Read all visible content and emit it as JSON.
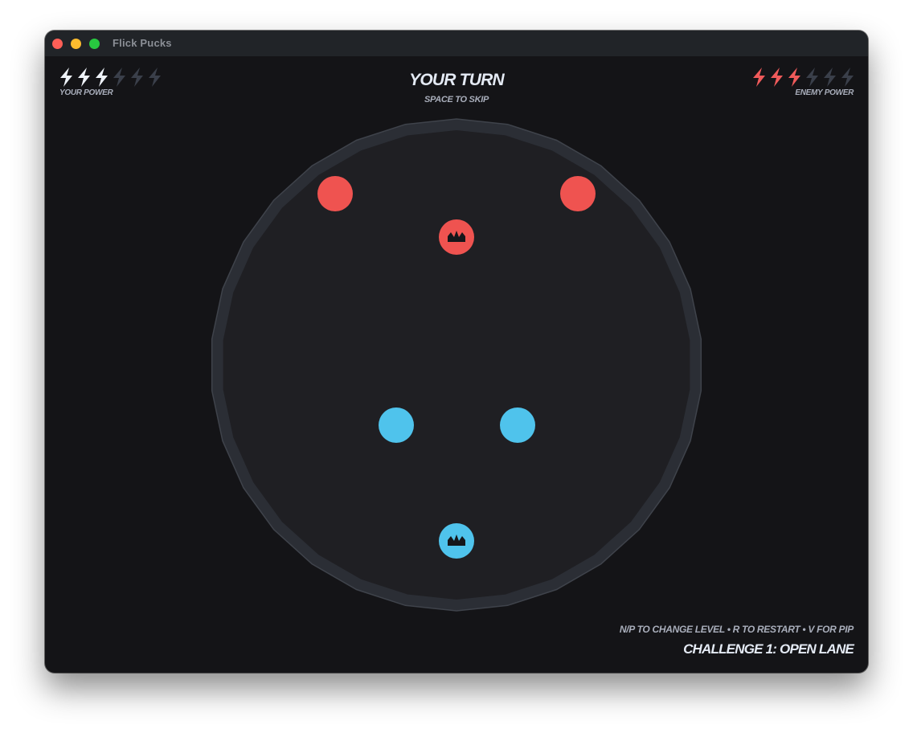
{
  "window": {
    "title": "Flick Pucks",
    "controls": [
      "close",
      "minimize",
      "maximize"
    ]
  },
  "hud": {
    "turn_label": "YOUR TURN",
    "skip_hint": "SPACE TO SKIP",
    "your_power_label": "YOUR POWER",
    "enemy_power_label": "ENEMY POWER",
    "your_power": {
      "current": 3,
      "max": 6
    },
    "enemy_power": {
      "current": 3,
      "max": 6
    },
    "controls_hint": "N/P TO CHANGE LEVEL • R TO RESTART • V FOR PIP",
    "level_name": "CHALLENGE 1: OPEN LANE"
  },
  "colors": {
    "player": "#4fc3ec",
    "enemy": "#ef5350",
    "bolt_active_player": "#eef2f8",
    "bolt_active_enemy": "#ef5a5a",
    "bolt_inactive": "#3a3f4a",
    "arena_floor": "#1f1f23",
    "arena_rim": "#2b2e35",
    "background": "#141417"
  },
  "arena": {
    "shape": "circle",
    "pucks": [
      {
        "team": "enemy",
        "kind": "puck",
        "icon": ""
      },
      {
        "team": "enemy",
        "kind": "puck",
        "icon": ""
      },
      {
        "team": "enemy",
        "kind": "king",
        "icon": "crown-icon"
      },
      {
        "team": "player",
        "kind": "puck",
        "icon": ""
      },
      {
        "team": "player",
        "kind": "puck",
        "icon": ""
      },
      {
        "team": "player",
        "kind": "king",
        "icon": "crown-icon"
      }
    ]
  }
}
